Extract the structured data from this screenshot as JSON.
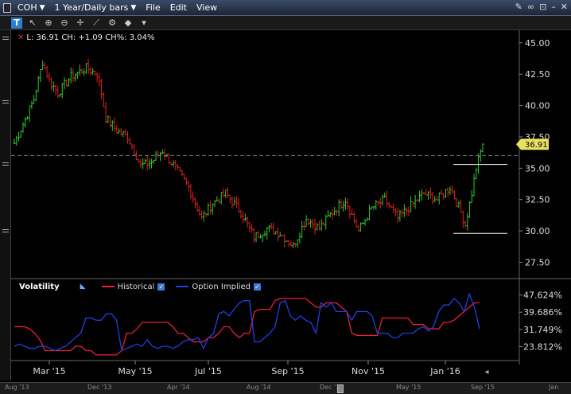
{
  "window": {
    "symbol": "COH",
    "period": "1 Year/Daily bars",
    "menu": [
      "File",
      "Edit",
      "View"
    ]
  },
  "readout": "L: 36.91  CH: +1.09  CH%: 3.04%",
  "price_tag": "36.91",
  "indicator": {
    "title": "Volatility",
    "historical_label": "Historical",
    "implied_label": "Option Implied"
  },
  "colors": {
    "up": "#2ecc2e",
    "down": "#e02020",
    "historical": "#e8203a",
    "implied": "#2040e0",
    "price_tag": "#e8e060"
  },
  "time_labels": [
    "Mar '15",
    "May '15",
    "Jul '15",
    "Sep '15",
    "Nov '15",
    "Jan '16"
  ],
  "overview_labels": [
    "Aug '13",
    "Dec '13",
    "Apr '14",
    "Aug '14",
    "Dec '14",
    "May '15",
    "Sep '15",
    "Jan"
  ],
  "chart_data": [
    {
      "type": "bar",
      "subtype": "ohlc",
      "y_ticks": [
        "45.00",
        "42.50",
        "40.00",
        "37.50",
        "35.00",
        "32.50",
        "30.00",
        "27.50"
      ],
      "ylim": [
        26.2,
        46.0
      ],
      "last": 36.91,
      "close_path": [
        [
          0,
          37.0
        ],
        [
          4,
          38.5
        ],
        [
          9,
          40.5
        ],
        [
          13,
          43.5
        ],
        [
          16,
          42.0
        ],
        [
          20,
          41.0
        ],
        [
          26,
          42.3
        ],
        [
          33,
          43.0
        ],
        [
          38,
          42.5
        ],
        [
          40,
          41.0
        ],
        [
          42,
          39.0
        ],
        [
          47,
          38.0
        ],
        [
          52,
          37.5
        ],
        [
          56,
          36.0
        ],
        [
          58,
          35.2
        ],
        [
          63,
          35.5
        ],
        [
          68,
          36.4
        ],
        [
          74,
          35.0
        ],
        [
          80,
          33.5
        ],
        [
          86,
          31.0
        ],
        [
          91,
          32.2
        ],
        [
          97,
          33.0
        ],
        [
          104,
          31.5
        ],
        [
          110,
          29.5
        ],
        [
          116,
          30.2
        ],
        [
          122,
          29.8
        ],
        [
          128,
          28.8
        ],
        [
          134,
          31.0
        ],
        [
          140,
          30.2
        ],
        [
          146,
          31.5
        ],
        [
          152,
          32.5
        ],
        [
          158,
          30.0
        ],
        [
          164,
          31.8
        ],
        [
          170,
          32.5
        ],
        [
          176,
          31.0
        ],
        [
          182,
          32.0
        ],
        [
          188,
          33.0
        ],
        [
          194,
          32.5
        ],
        [
          200,
          33.5
        ],
        [
          205,
          31.5
        ],
        [
          207,
          30.5
        ],
        [
          210,
          33.0
        ],
        [
          212,
          35.0
        ],
        [
          215,
          36.91
        ]
      ],
      "levels": [
        35.3,
        29.8
      ]
    },
    {
      "type": "line",
      "y_ticks": [
        "47.624%",
        "39.686%",
        "31.749%",
        "23.812%"
      ],
      "ylim": [
        18.5,
        51.5
      ],
      "series": [
        {
          "name": "Historical",
          "values": [
            33,
            33,
            33,
            32,
            30,
            27,
            22,
            22,
            22,
            22,
            22,
            22,
            24,
            24,
            22,
            22,
            20,
            20,
            20,
            20,
            20,
            22,
            30,
            30,
            32,
            35,
            35,
            35,
            35,
            35,
            35,
            33,
            30,
            30,
            28,
            26,
            26,
            26,
            28,
            28,
            30,
            33,
            33,
            30,
            28,
            30,
            30,
            40,
            41,
            41,
            41,
            45,
            46,
            46,
            46,
            46,
            46,
            46,
            44,
            42,
            42,
            44,
            44,
            44,
            42,
            40,
            30,
            29,
            29,
            29,
            29,
            29,
            37,
            37,
            37,
            37,
            37,
            37,
            34,
            34,
            34,
            32,
            32,
            32,
            35,
            35,
            36,
            38,
            40,
            42,
            44,
            44
          ]
        },
        {
          "name": "Option Implied",
          "values": [
            24,
            25,
            24,
            23,
            23,
            24,
            24,
            23,
            22,
            23,
            24,
            26,
            28,
            30,
            37,
            37,
            36,
            36,
            39,
            39,
            36,
            22,
            23,
            24,
            25,
            24,
            27,
            24,
            23,
            24,
            24,
            23,
            24,
            26,
            27,
            27,
            28,
            23,
            28,
            30,
            39,
            40,
            38,
            41,
            44,
            45,
            45,
            26,
            26,
            28,
            30,
            33,
            44,
            45,
            38,
            36,
            38,
            36,
            35,
            30,
            44,
            42,
            44,
            40,
            40,
            40,
            36,
            40,
            40,
            40,
            38,
            30,
            30,
            30,
            28,
            28,
            30,
            30,
            30,
            32,
            33,
            31,
            33,
            40,
            43,
            43,
            46,
            44,
            40,
            48,
            42,
            32
          ]
        }
      ]
    }
  ]
}
